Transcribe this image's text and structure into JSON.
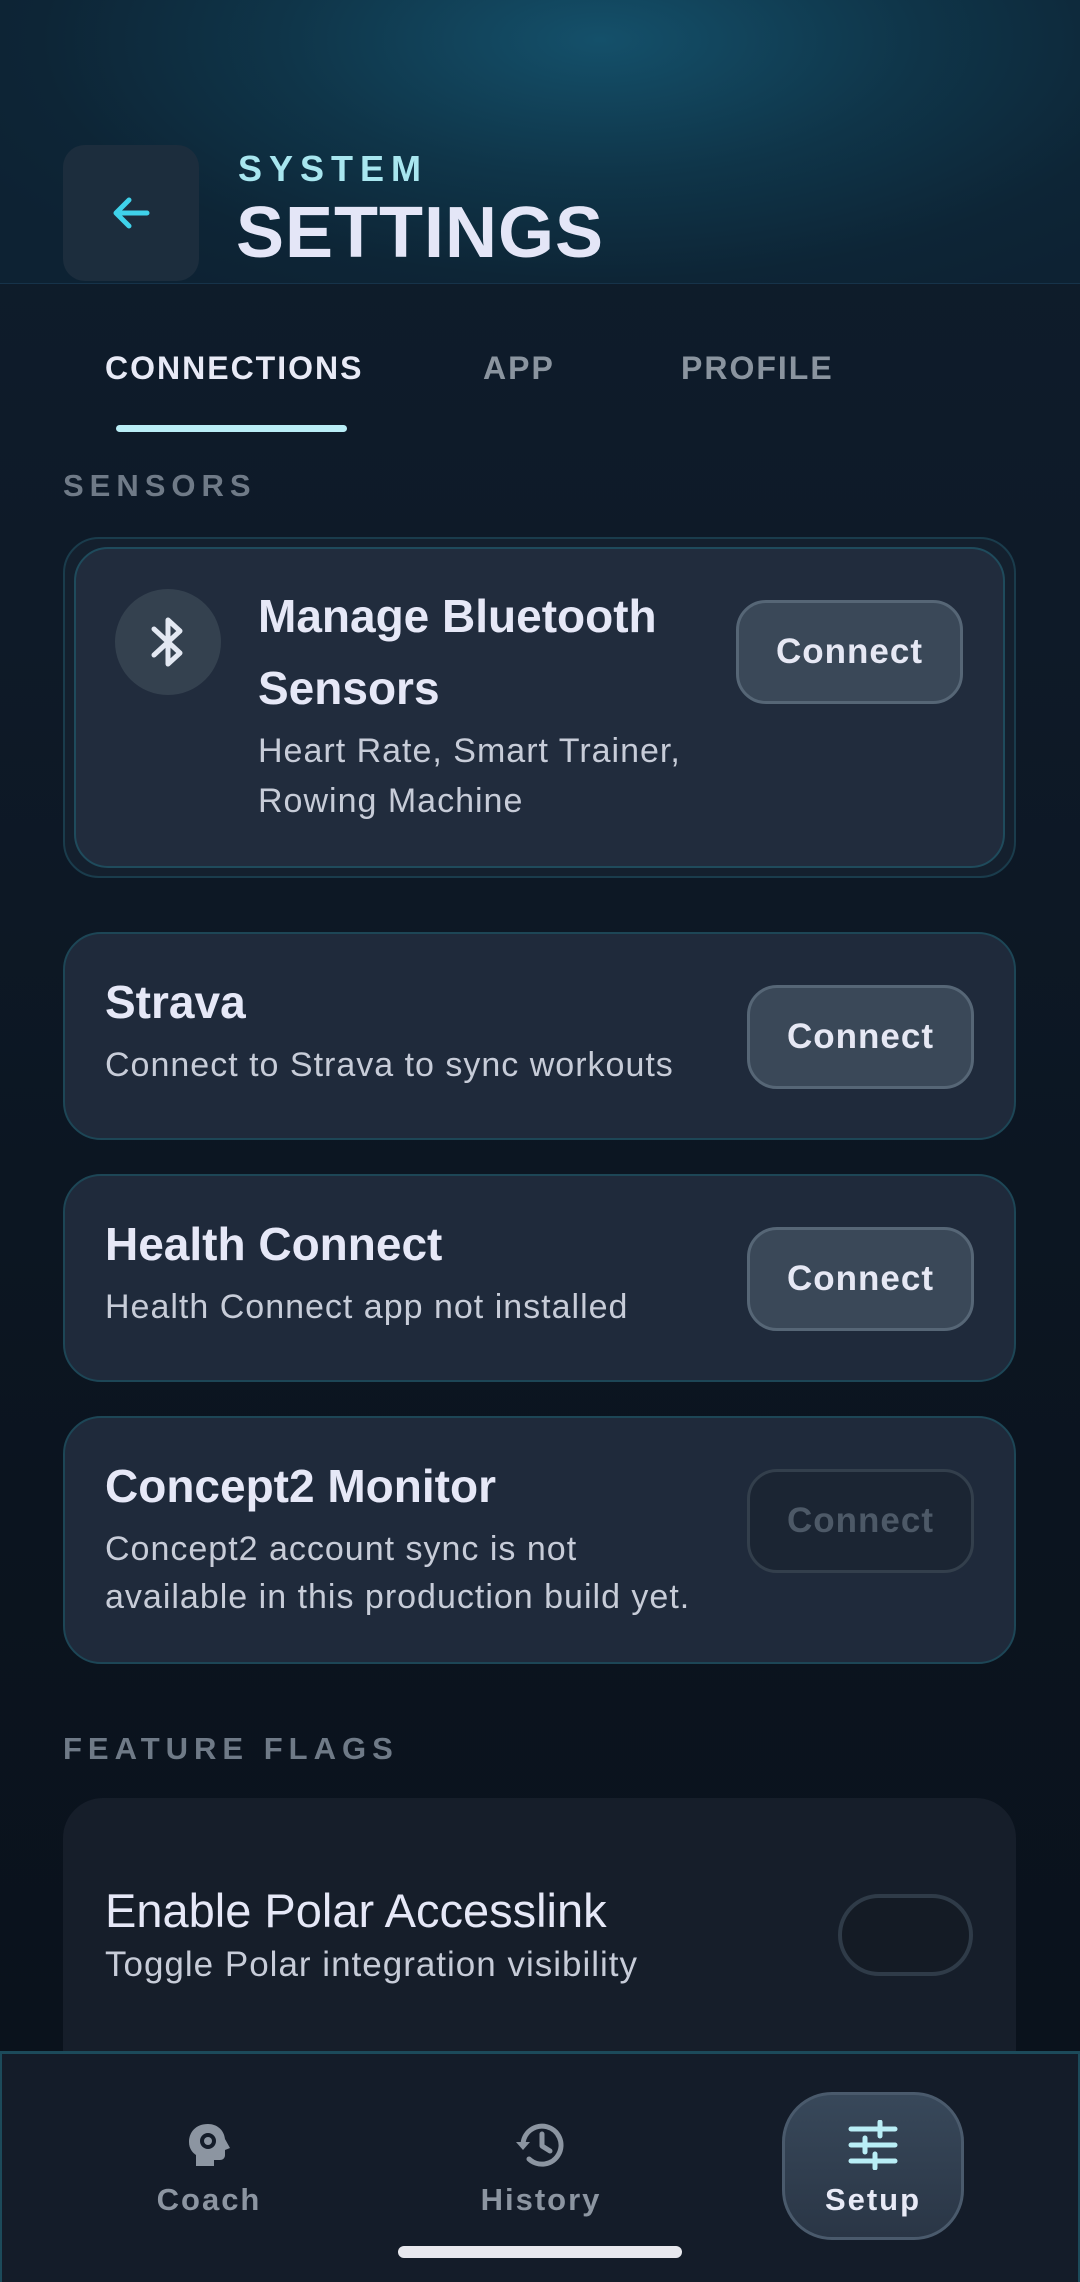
{
  "header": {
    "kicker": "SYSTEM",
    "title": "SETTINGS",
    "back_icon": "arrow-left-icon"
  },
  "tabs": [
    {
      "label": "CONNECTIONS",
      "active": true
    },
    {
      "label": "APP",
      "active": false
    },
    {
      "label": "PROFILE",
      "active": false
    }
  ],
  "sections": {
    "sensors_label": "SENSORS",
    "feature_flags_label": "FEATURE FLAGS"
  },
  "bluetooth": {
    "title_line1": "Manage Bluetooth",
    "title_line2": "Sensors",
    "subtitle_line1": "Heart Rate, Smart Trainer,",
    "subtitle_line2": "Rowing Machine",
    "button": "Connect",
    "icon": "bluetooth-icon"
  },
  "connections": [
    {
      "title": "Strava",
      "subtitle_line1": "Connect to Strava to sync workouts",
      "subtitle_line2": "",
      "button": "Connect",
      "enabled": true
    },
    {
      "title": "Health Connect",
      "subtitle_line1": "Health Connect app not installed",
      "subtitle_line2": "",
      "button": "Connect",
      "enabled": true
    },
    {
      "title": "Concept2 Monitor",
      "subtitle_line1": "Concept2 account sync is not",
      "subtitle_line2": "available in this production build yet.",
      "button": "Connect",
      "enabled": false
    }
  ],
  "feature_flag": {
    "title": "Enable Polar Accesslink",
    "subtitle": "Toggle Polar integration visibility",
    "enabled": false
  },
  "bottom_nav": [
    {
      "label": "Coach",
      "icon": "brain-gear-icon",
      "active": false
    },
    {
      "label": "History",
      "icon": "history-icon",
      "active": false
    },
    {
      "label": "Setup",
      "icon": "sliders-icon",
      "active": true
    }
  ],
  "colors": {
    "accent": "#5ad8ec",
    "tab_indicator": "#b9eef6",
    "card_bg": "#1f2a3b",
    "card_border": "#1d4656"
  }
}
